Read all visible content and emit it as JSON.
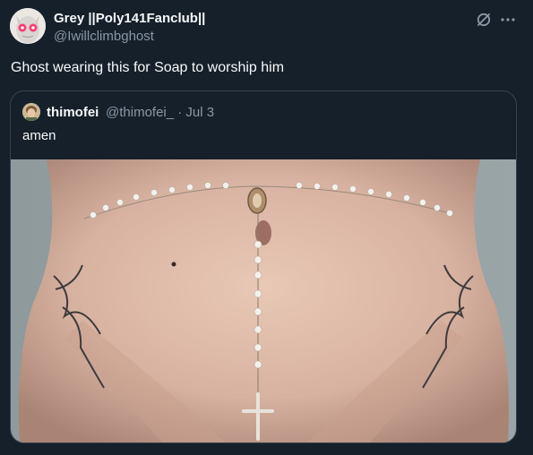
{
  "tweet": {
    "display_name": "Grey ||Poly141Fanclub||",
    "handle": "@Iwillclimbghost",
    "text": "Ghost wearing this for Soap to worship him",
    "icons": [
      "grok-icon",
      "more-icon"
    ]
  },
  "quote": {
    "display_name": "thimofei",
    "handle_and_date": "@thimofei_ · Jul 3",
    "text": "amen",
    "media_description_icon": "photo"
  },
  "colors": {
    "background": "#15202b",
    "primary_text": "#f7f9f9",
    "secondary_text": "#8b98a5",
    "border": "#38444d"
  }
}
